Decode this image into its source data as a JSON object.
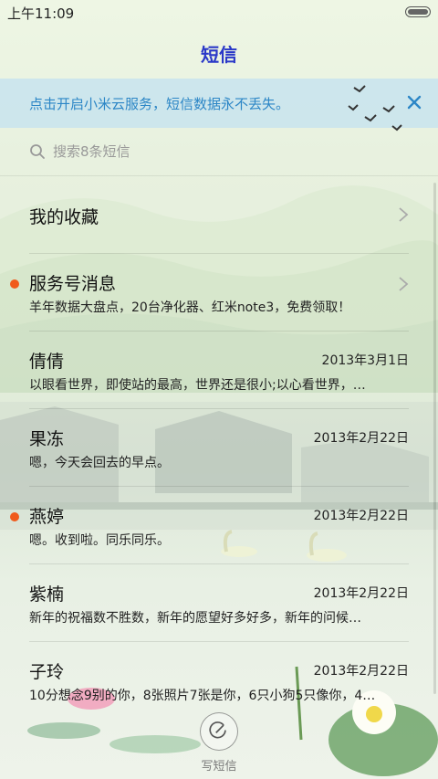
{
  "status_bar": {
    "time": "上午11:09"
  },
  "header": {
    "title": "短信"
  },
  "banner": {
    "text": "点击开启小米云服务，短信数据永不丢失。"
  },
  "search": {
    "placeholder": "搜索8条短信"
  },
  "favorites": {
    "label": "我的收藏"
  },
  "service": {
    "title": "服务号消息",
    "snippet": "羊年数据大盘点，20台净化器、红米note3，免费领取！",
    "unread": true
  },
  "conversations": [
    {
      "name": "倩倩",
      "date": "2013年3月1日",
      "snippet": "以眼看世界，即使站的最高，世界还是很小;以心看世界，…",
      "unread": false
    },
    {
      "name": "果冻",
      "date": "2013年2月22日",
      "snippet": "嗯，今天会回去的早点。",
      "unread": false
    },
    {
      "name": "燕婷",
      "date": "2013年2月22日",
      "snippet": "嗯。收到啦。同乐同乐。",
      "unread": true
    },
    {
      "name": "紫楠",
      "date": "2013年2月22日",
      "snippet": "新年的祝福数不胜数，新年的愿望好多好多，新年的问候…",
      "unread": false
    },
    {
      "name": "子玲",
      "date": "2013年2月22日",
      "snippet": "10分想念9别的你，8张照片7张是你，6只小狗5只像你，4…",
      "unread": false
    }
  ],
  "compose": {
    "label": "写短信"
  },
  "colors": {
    "title": "#2a38c8",
    "banner_text": "#2c86c6",
    "unread_dot": "#f05a1c"
  }
}
